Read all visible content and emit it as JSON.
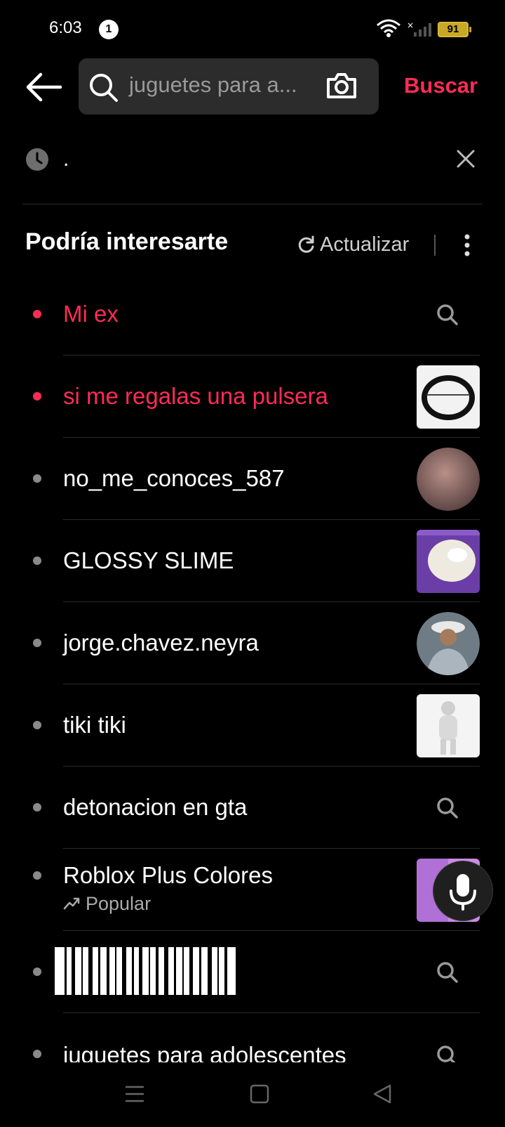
{
  "status": {
    "time": "6:03",
    "notification_count": "1",
    "battery": "91"
  },
  "search": {
    "query": "juguetes para a...",
    "submit_label": "Buscar"
  },
  "history": [
    {
      "text": "."
    }
  ],
  "suggestions_section": {
    "title": "Podría interesarte",
    "refresh_label": "Actualizar"
  },
  "suggestions": [
    {
      "label": "Mi ex",
      "highlight": true,
      "trailing": "search-icon"
    },
    {
      "label": "si me regalas una pulsera",
      "highlight": true,
      "trailing": "thumbnail"
    },
    {
      "label": "no_me_conoces_587",
      "highlight": false,
      "trailing": "avatar"
    },
    {
      "label": "GLOSSY SLIME",
      "highlight": false,
      "trailing": "thumbnail"
    },
    {
      "label": "jorge.chavez.neyra",
      "highlight": false,
      "trailing": "avatar"
    },
    {
      "label": "tiki tiki",
      "highlight": false,
      "trailing": "thumbnail"
    },
    {
      "label": "detonacion en gta",
      "highlight": false,
      "trailing": "search-icon"
    },
    {
      "label": "Roblox Plus Colores",
      "sub": "Popular",
      "highlight": false,
      "trailing": "thumbnail"
    },
    {
      "label": "",
      "highlight": false,
      "trailing": "search-icon"
    },
    {
      "label": "juguetes para adolescentes",
      "highlight": false,
      "trailing": "search-icon"
    }
  ],
  "colors": {
    "accent": "#fe2c55",
    "background": "#000000",
    "search_bg": "#2c2c2c"
  }
}
